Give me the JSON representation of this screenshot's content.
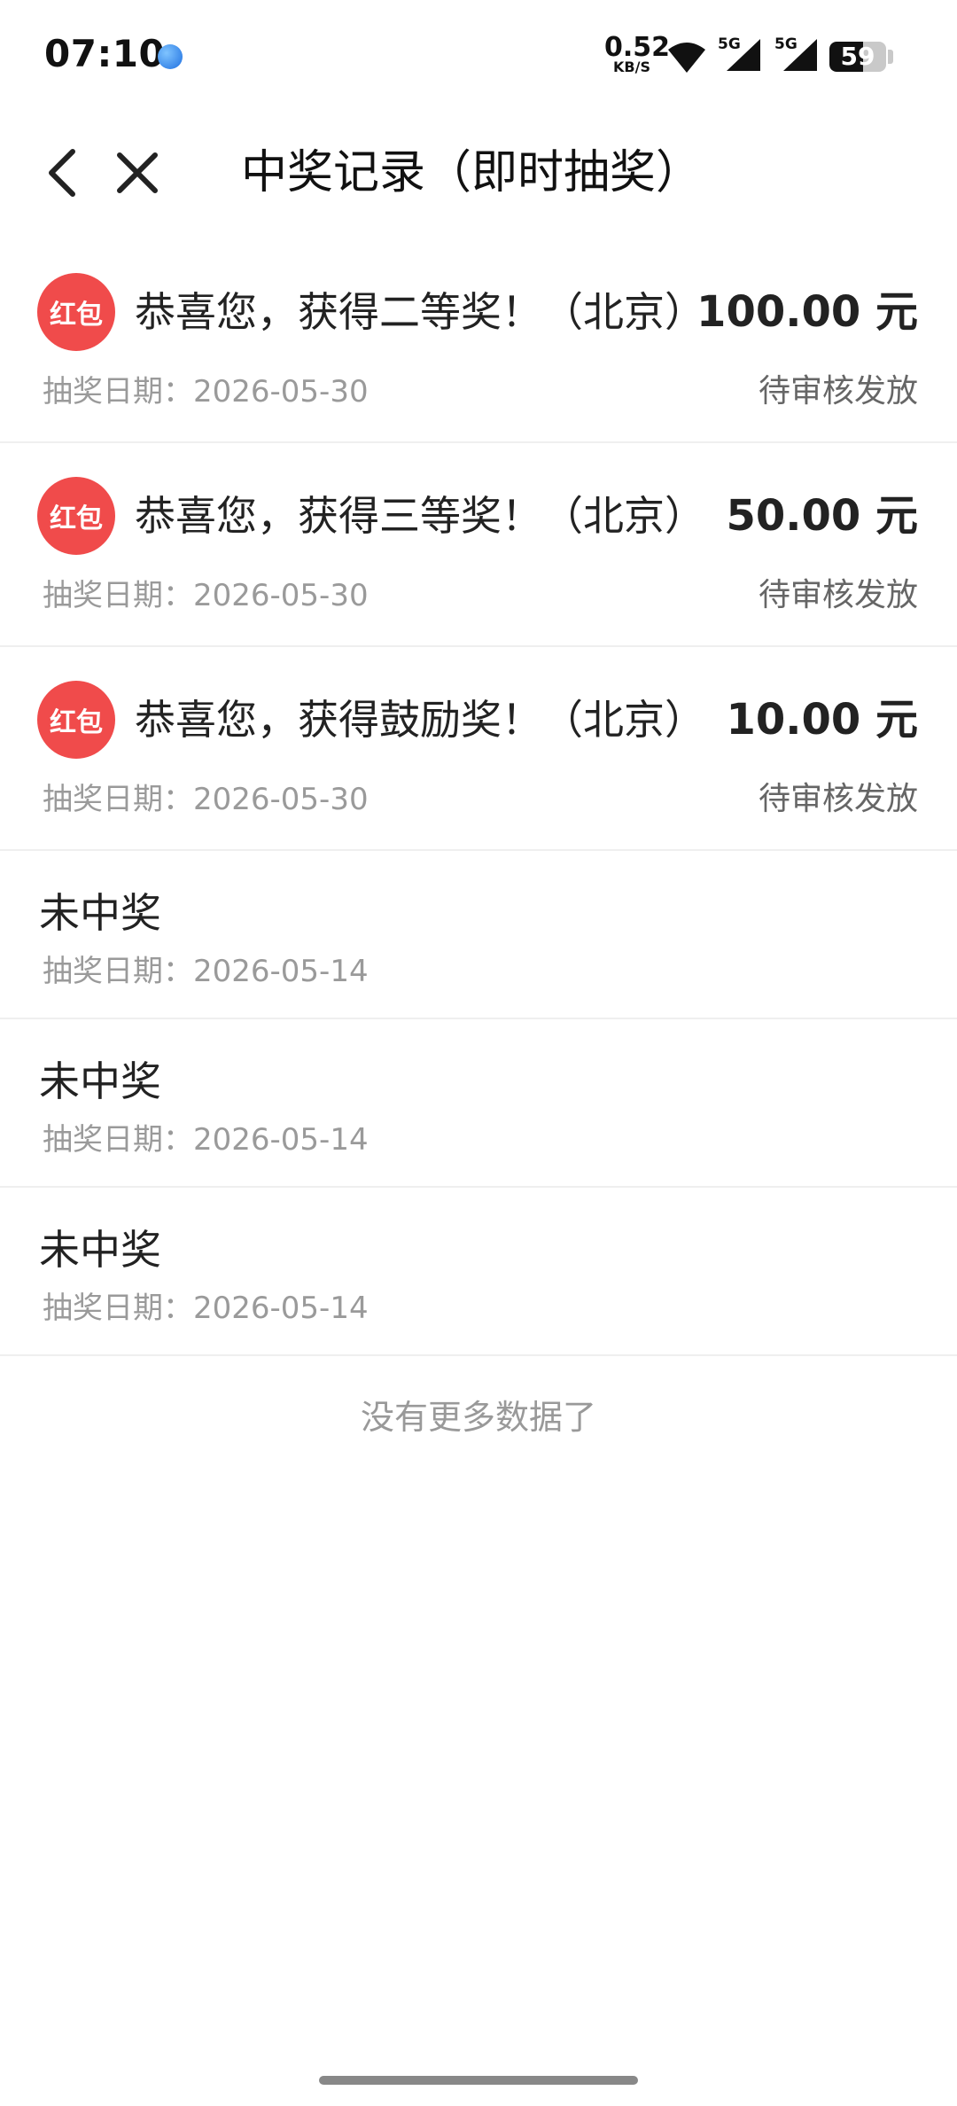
{
  "status_bar": {
    "time": "07:10",
    "net_speed_value": "0.52",
    "net_speed_unit": "KB/S",
    "signal1_label": "5G",
    "signal2_label": "5G",
    "battery_level": "59",
    "icons": [
      "app-notification-icon",
      "wifi-icon",
      "signal-icon",
      "signal-icon",
      "battery-icon"
    ]
  },
  "header": {
    "title": "中奖记录（即时抽奖）",
    "back_icon": "chevron-left-icon",
    "close_icon": "close-icon"
  },
  "records": [
    {
      "type": "win",
      "badge": "红包",
      "text": "恭喜您，获得二等奖！（北京）",
      "amount": "100.00 元",
      "date_label": "抽奖日期：2026-05-30",
      "status": "待审核发放"
    },
    {
      "type": "win",
      "badge": "红包",
      "text": "恭喜您，获得三等奖！（北京）",
      "amount": "50.00 元",
      "date_label": "抽奖日期：2026-05-30",
      "status": "待审核发放"
    },
    {
      "type": "win",
      "badge": "红包",
      "text": "恭喜您，获得鼓励奖！（北京）",
      "amount": "10.00 元",
      "date_label": "抽奖日期：2026-05-30",
      "status": "待审核发放"
    },
    {
      "type": "lose",
      "text": "未中奖",
      "date_label": "抽奖日期：2026-05-14"
    },
    {
      "type": "lose",
      "text": "未中奖",
      "date_label": "抽奖日期：2026-05-14"
    },
    {
      "type": "lose",
      "text": "未中奖",
      "date_label": "抽奖日期：2026-05-14"
    }
  ],
  "footer": {
    "no_more": "没有更多数据了"
  },
  "colors": {
    "badge": "#f04b4b",
    "secondary_text": "#9a9a9a",
    "divider": "#efefef"
  }
}
